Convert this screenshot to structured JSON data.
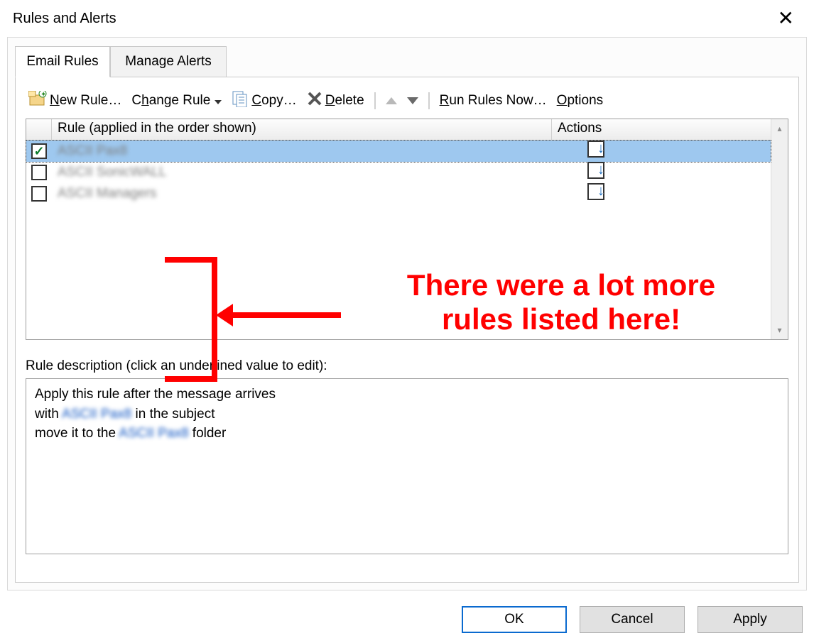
{
  "dialog": {
    "title": "Rules and Alerts",
    "close_label": "✕"
  },
  "tabs": {
    "email_rules": "Email Rules",
    "manage_alerts": "Manage Alerts"
  },
  "toolbar": {
    "new_rule": "New Rule…",
    "change_rule": "Change Rule",
    "copy": "Copy…",
    "delete": "Delete",
    "run_rules_now": "Run Rules Now…",
    "options": "Options"
  },
  "grid": {
    "header_rule": "Rule (applied in the order shown)",
    "header_actions": "Actions",
    "rows": [
      {
        "checked": true,
        "name": "ASCII Pax8",
        "action_icon": "move-to-folder"
      },
      {
        "checked": false,
        "name": "ASCII SonicWALL",
        "action_icon": "move-to-folder"
      },
      {
        "checked": false,
        "name": "ASCII Managers",
        "action_icon": "move-to-folder"
      }
    ]
  },
  "description": {
    "label": "Rule description (click an underlined value to edit):",
    "line1": "Apply this rule after the message arrives",
    "line2_prefix": "with ",
    "line2_link": "ASCII Pax8",
    "line2_suffix": " in the subject",
    "line3_prefix": "move it to the ",
    "line3_link": "ASCII Pax8",
    "line3_suffix": " folder"
  },
  "buttons": {
    "ok": "OK",
    "cancel": "Cancel",
    "apply": "Apply"
  },
  "annotation": {
    "text_line1": "There were a lot more",
    "text_line2": "rules listed here!"
  }
}
